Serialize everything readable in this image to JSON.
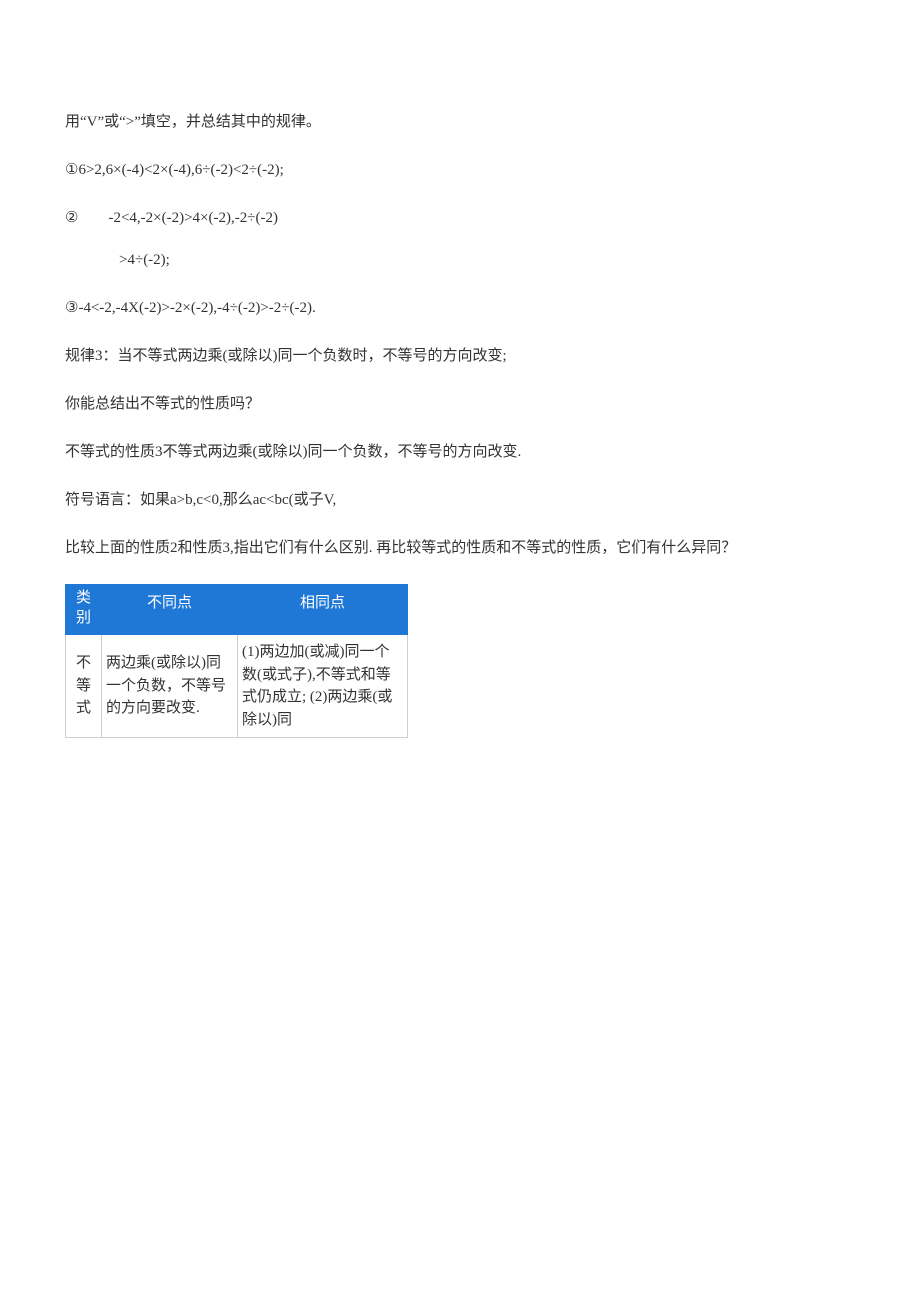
{
  "paragraphs": {
    "p1": "用“V”或“>”填空，并总结其中的规律。",
    "p2": "①6>2,6×(-4)<2×(-4),6÷(-2)<2÷(-2);",
    "p3a": "②　　-2<4,-2×(-2)>4×(-2),-2÷(-2)",
    "p3b": ">4÷(-2);",
    "p4": "③-4<-2,-4X(-2)>-2×(-2),-4÷(-2)>-2÷(-2).",
    "p5": "规律3：当不等式两边乘(或除以)同一个负数时，不等号的方向改变;",
    "p6": "你能总结出不等式的性质吗？",
    "p7": "不等式的性质3不等式两边乘(或除以)同一个负数，不等号的方向改变.",
    "p8": "符号语言：如果a>b,c<0,那么ac<bc(或子V,",
    "p9": "比较上面的性质2和性质3,指出它们有什么区别. 再比较等式的性质和不等式的性质，它们有什么异同？"
  },
  "table": {
    "headers": {
      "col1": "类别",
      "col2": "不同点",
      "col3": "相同点"
    },
    "row1": {
      "cell1": "不等式",
      "cell2": "两边乘(或除以)同一个负数，不等号的方向要改变.",
      "cell3": "(1)两边加(或减)同一个数(或式子),不等式和等式仍成立;\n(2)两边乘(或除以)同"
    }
  }
}
